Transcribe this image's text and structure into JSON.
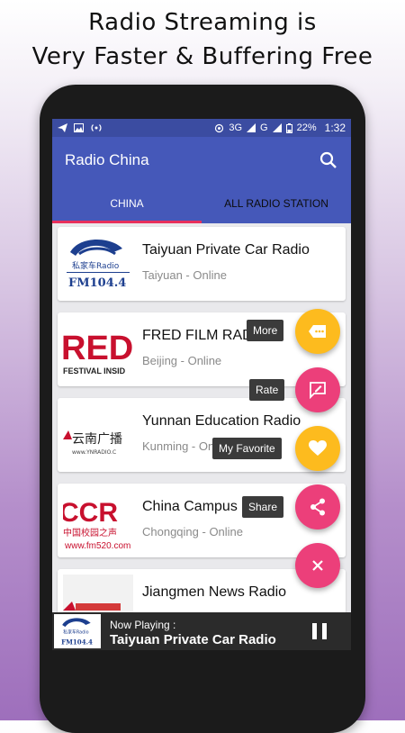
{
  "promo": {
    "line1": "Radio Streaming is",
    "line2": "Very Faster & Buffering Free"
  },
  "status_bar": {
    "network": "3G",
    "network2": "G",
    "battery": "22%",
    "time": "1:32"
  },
  "app_bar": {
    "title": "Radio China",
    "search_icon": "search-icon"
  },
  "tabs": [
    {
      "label": "CHINA",
      "active": true
    },
    {
      "label": "ALL RADIO STATION",
      "active": false
    }
  ],
  "stations": [
    {
      "name": "Taiyuan Private Car Radio",
      "sub": "Taiyuan - Online",
      "logo_text": "FM104.4"
    },
    {
      "name": "FRED FILM RAD",
      "sub": "Beijing - Online",
      "logo_text": "RED"
    },
    {
      "name": "Yunnan Education Radio",
      "sub": "Kunming - On",
      "logo_text": "云南广播"
    },
    {
      "name": "China Campus",
      "sub": "Chongqing - Online",
      "logo_text": "CCR"
    },
    {
      "name": "Jiangmen News Radio",
      "sub": "",
      "logo_text": ""
    }
  ],
  "fab_menu": {
    "more": "More",
    "rate": "Rate",
    "favorite": "My Favorite",
    "share": "Share",
    "colors": {
      "yellow": "#fdbb1e",
      "pink": "#ec3f7a"
    }
  },
  "now_playing": {
    "label": "Now Playing :",
    "title": "Taiyuan Private Car Radio"
  }
}
